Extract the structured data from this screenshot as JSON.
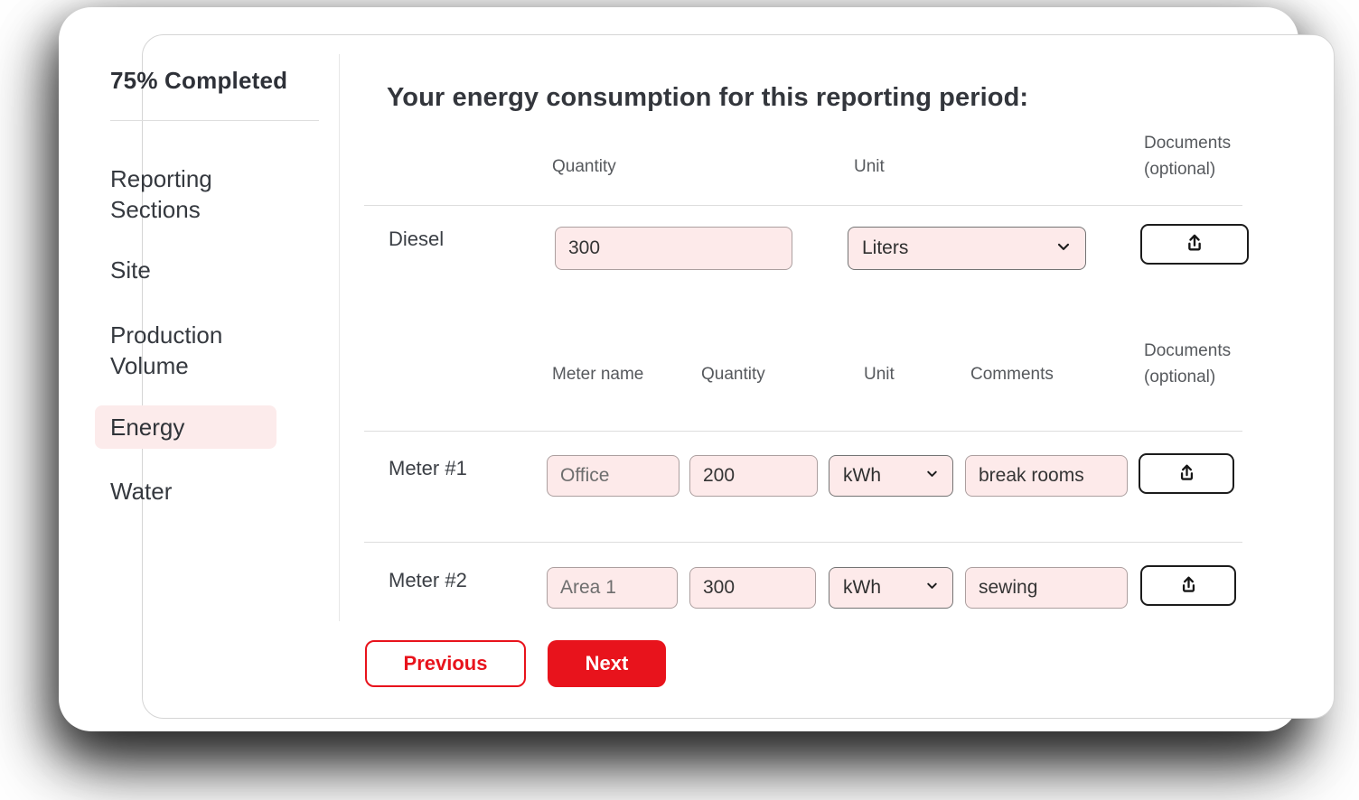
{
  "sidebar": {
    "progress_label": "75% Completed",
    "items": [
      {
        "label": "Reporting Sections",
        "active": false
      },
      {
        "label": "Site",
        "active": false
      },
      {
        "label": "Production Volume",
        "active": false
      },
      {
        "label": "Energy",
        "active": true
      },
      {
        "label": "Water",
        "active": false
      }
    ]
  },
  "main": {
    "title": "Your energy consumption for this reporting period:",
    "fuel_table": {
      "headers": {
        "quantity": "Quantity",
        "unit": "Unit",
        "documents_line1": "Documents",
        "documents_line2": "(optional)"
      },
      "rows": [
        {
          "label": "Diesel",
          "quantity": "300",
          "unit": "Liters"
        }
      ]
    },
    "meter_table": {
      "headers": {
        "meter_name": "Meter name",
        "quantity": "Quantity",
        "unit": "Unit",
        "comments": "Comments",
        "documents_line1": "Documents",
        "documents_line2": "(optional)"
      },
      "rows": [
        {
          "label": "Meter #1",
          "meter_name": "Office",
          "quantity": "200",
          "unit": "kWh",
          "comments": "break rooms"
        },
        {
          "label": "Meter #2",
          "meter_name": "Area 1",
          "quantity": "300",
          "unit": "kWh",
          "comments": "sewing"
        }
      ]
    },
    "buttons": {
      "previous": "Previous",
      "next": "Next"
    }
  },
  "colors": {
    "accent_red": "#e8131c",
    "input_pink": "#fdeaea",
    "active_nav_pink": "#fcebeb",
    "text_dark": "#33363c",
    "text_muted": "#56595d"
  }
}
